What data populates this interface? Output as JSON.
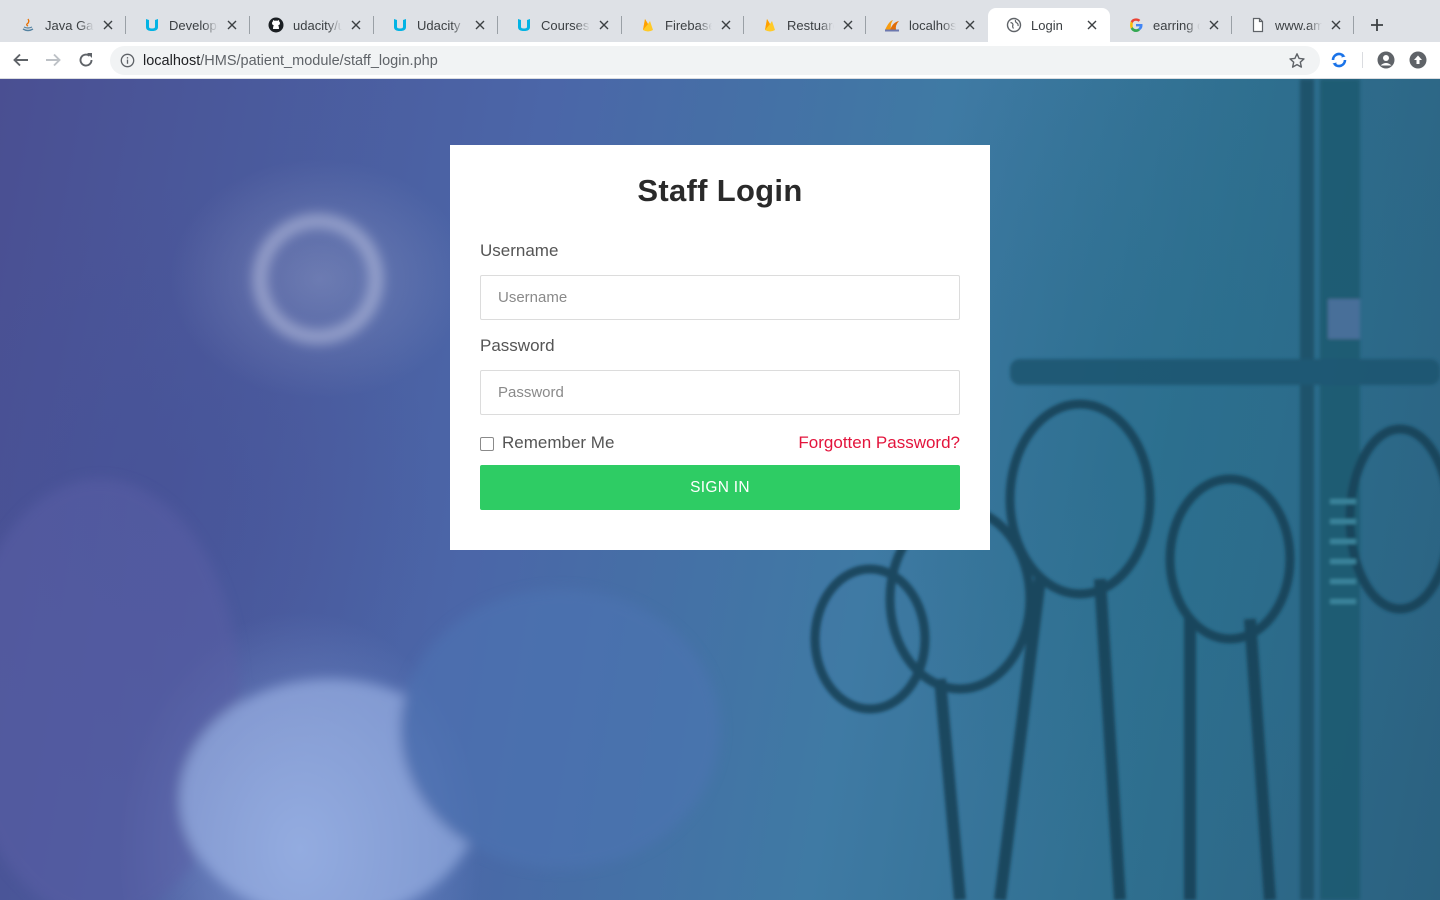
{
  "browser": {
    "tabs": [
      {
        "title": "Java Game",
        "favicon": "java-icon",
        "active": false
      },
      {
        "title": "Developing",
        "favicon": "udacity-icon",
        "active": false
      },
      {
        "title": "udacity/ud",
        "favicon": "github-icon",
        "active": false
      },
      {
        "title": "Udacity",
        "favicon": "udacity-icon",
        "active": false
      },
      {
        "title": "Courses |",
        "favicon": "udacity-icon",
        "active": false
      },
      {
        "title": "Firebase",
        "favicon": "firebase-icon",
        "active": false
      },
      {
        "title": "Restuaren",
        "favicon": "firebase-icon",
        "active": false
      },
      {
        "title": "localhost /",
        "favicon": "phpmyadmin-icon",
        "active": false
      },
      {
        "title": "Login",
        "favicon": "globe-icon",
        "active": true
      },
      {
        "title": "earring on",
        "favicon": "google-icon",
        "active": false
      },
      {
        "title": "www.ama",
        "favicon": "document-icon",
        "active": false
      }
    ],
    "url_host": "localhost",
    "url_path": "/HMS/patient_module/staff_login.php"
  },
  "login": {
    "title": "Staff Login",
    "username_label": "Username",
    "username_placeholder": "Username",
    "username_value": "",
    "password_label": "Password",
    "password_placeholder": "Password",
    "password_value": "",
    "remember_label": "Remember Me",
    "remember_checked": false,
    "forgot_link": "Forgotten Password?",
    "signin_label": "SIGN IN"
  },
  "colors": {
    "signin_button": "#2ecc64",
    "forgot_link": "#e3143c",
    "active_tab": "#ffffff",
    "tab_strip": "#dee1e6"
  }
}
